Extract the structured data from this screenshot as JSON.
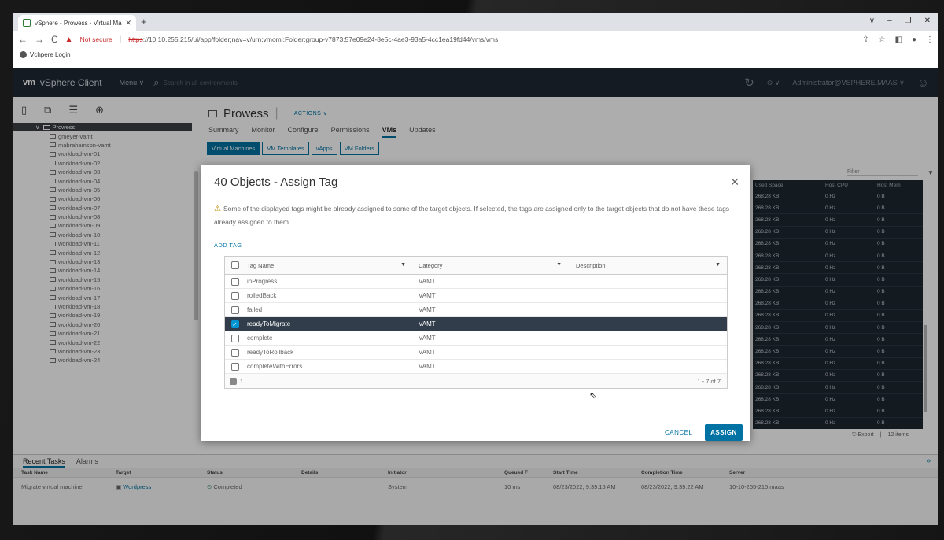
{
  "browser": {
    "tab_title": "vSphere - Prowess - Virtual Mach",
    "nav_back": "←",
    "nav_forward": "→",
    "nav_reload": "C",
    "not_secure": "Not secure",
    "url_scheme": "https",
    "url_rest": "://10.10.255.215/ui/app/folder;nav=v/urn:vmomi:Folder:group-v7873:57e09e24-8e5c-4ae3-93a5-4cc1ea19fd44/vms/vms",
    "bookmark": "Vchpere Login"
  },
  "header": {
    "logo": "vm",
    "brand": "vSphere Client",
    "menu": "Menu ∨",
    "search_placeholder": "Search in all environments",
    "user": "Administrator@VSPHERE.MAAS ∨"
  },
  "tree": {
    "selected": "Prowess",
    "items": [
      "gmeyer-vamt",
      "mabrahamson-vamt",
      "workload-vm-01",
      "workload-vm-02",
      "workload-vm-03",
      "workload-vm-04",
      "workload-vm-05",
      "workload-vm-06",
      "workload-vm-07",
      "workload-vm-08",
      "workload-vm-09",
      "workload-vm-10",
      "workload-vm-11",
      "workload-vm-12",
      "workload-vm-13",
      "workload-vm-14",
      "workload-vm-15",
      "workload-vm-16",
      "workload-vm-17",
      "workload-vm-18",
      "workload-vm-19",
      "workload-vm-20",
      "workload-vm-21",
      "workload-vm-22",
      "workload-vm-23",
      "workload-vm-24"
    ]
  },
  "content": {
    "title": "Prowess",
    "actions": "ACTIONS ∨",
    "tabs": [
      "Summary",
      "Monitor",
      "Configure",
      "Permissions",
      "VMs",
      "Updates"
    ],
    "subtabs": [
      "Virtual Machines",
      "VM Templates",
      "vApps",
      "VM Folders"
    ],
    "filter_placeholder": "Filter",
    "grid_headers": [
      "Used Space",
      "Host CPU",
      "Host Mem"
    ],
    "grid_row": [
      "268.28 KB",
      "0 Hz",
      "0 B"
    ],
    "export": "Export",
    "items_count": "12 items"
  },
  "tasks": {
    "tabs": [
      "Recent Tasks",
      "Alarms"
    ],
    "headers": [
      "Task Name",
      "Target",
      "Status",
      "Details",
      "Initiator",
      "Queued F",
      "Start Time",
      "Completion Time",
      "Server"
    ],
    "row": {
      "task": "Migrate virtual machine",
      "target": "Wordpress",
      "status": "Completed",
      "initiator": "System",
      "queued": "10 ms",
      "start": "08/23/2022, 9:39:16 AM",
      "completion": "08/23/2022, 9:39:22 AM",
      "server": "10-10-255-215.maas"
    }
  },
  "modal": {
    "title": "40 Objects - Assign Tag",
    "info": "Some of the displayed tags might be already assigned to some of the target objects. If selected, the tags are assigned only to the target objects that do not have these tags already assigned to them.",
    "add_tag": "ADD TAG",
    "columns": {
      "name": "Tag Name",
      "category": "Category",
      "description": "Description"
    },
    "rows": [
      {
        "name": "inProgress",
        "category": "VAMT",
        "selected": false
      },
      {
        "name": "rolledBack",
        "category": "VAMT",
        "selected": false
      },
      {
        "name": "failed",
        "category": "VAMT",
        "selected": false
      },
      {
        "name": "readyToMigrate",
        "category": "VAMT",
        "selected": true
      },
      {
        "name": "complete",
        "category": "VAMT",
        "selected": false
      },
      {
        "name": "readyToRollback",
        "category": "VAMT",
        "selected": false
      },
      {
        "name": "completeWithErrors",
        "category": "VAMT",
        "selected": false
      }
    ],
    "selected_count": "1",
    "pagination": "1 - 7 of 7",
    "cancel": "CANCEL",
    "assign": "ASSIGN"
  }
}
